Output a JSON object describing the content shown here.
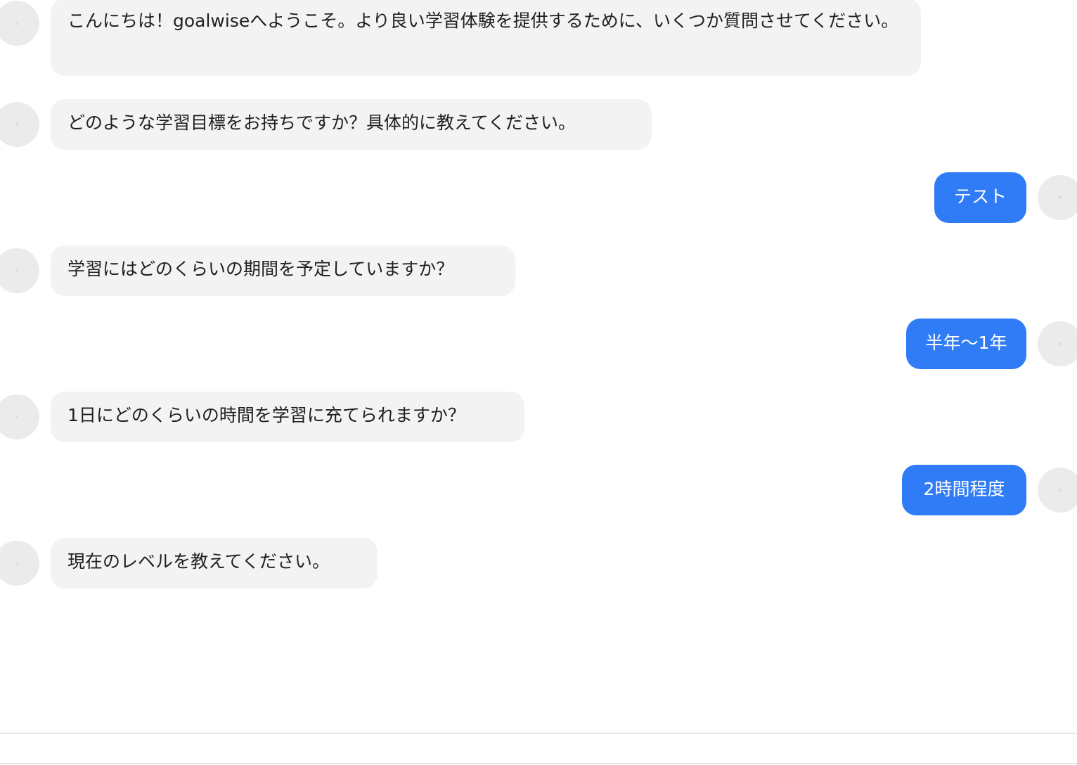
{
  "messages": [
    {
      "role": "assistant",
      "avatar_icon": "avatar-icon",
      "text": "こんにちは！goalwiseへようこそ。より良い学習体験を提供するために、いくつか質問させてください。"
    },
    {
      "role": "assistant",
      "avatar_icon": "avatar-icon",
      "text": "どのような学習目標をお持ちですか？具体的に教えてください。"
    },
    {
      "role": "user",
      "avatar_icon": "avatar-icon",
      "text": "テスト"
    },
    {
      "role": "assistant",
      "avatar_icon": "avatar-icon",
      "text": "学習にはどのくらいの期間を予定していますか？"
    },
    {
      "role": "user",
      "avatar_icon": "avatar-icon",
      "text": "半年〜1年"
    },
    {
      "role": "assistant",
      "avatar_icon": "avatar-icon",
      "text": "1日にどのくらいの時間を学習に充てられますか？"
    },
    {
      "role": "user",
      "avatar_icon": "avatar-icon",
      "text": "2時間程度"
    },
    {
      "role": "assistant",
      "avatar_icon": "avatar-icon",
      "text": "現在のレベルを教えてください。"
    }
  ],
  "colors": {
    "assistant_bubble": "#f3f3f3",
    "user_bubble": "#2f7cf6",
    "avatar": "#ebebeb",
    "divider": "#e6e6e6"
  }
}
